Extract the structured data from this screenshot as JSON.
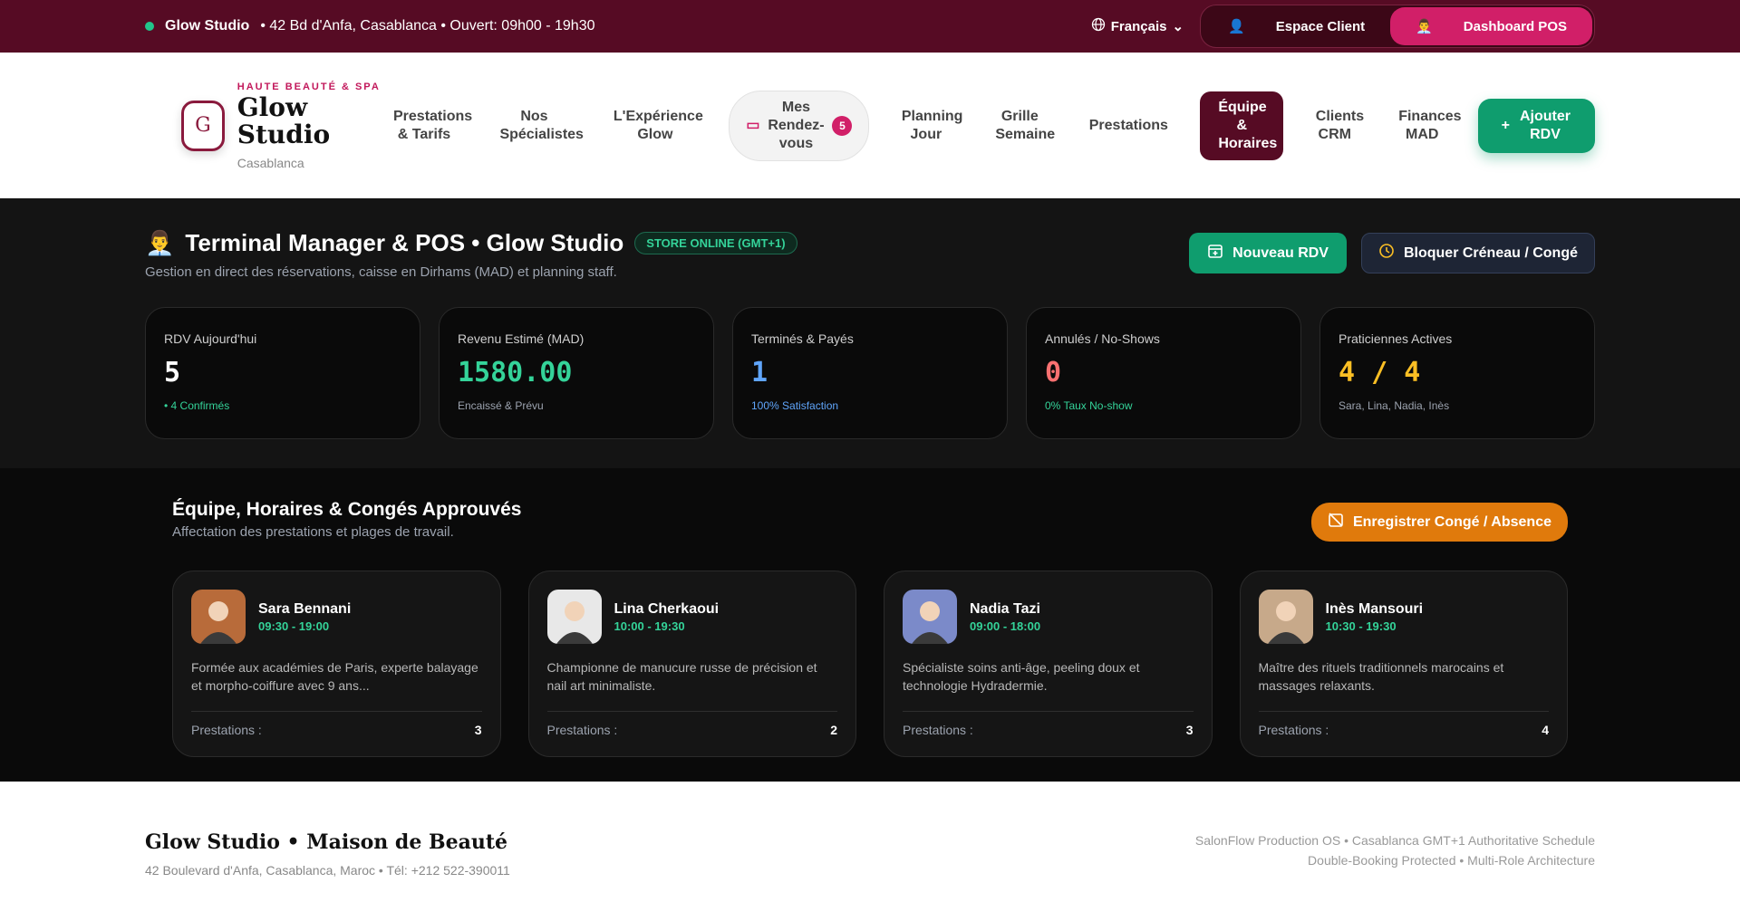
{
  "topbar": {
    "salon": "Glow Studio",
    "info": "• 42 Bd d'Anfa, Casablanca • Ouvert: 09h00 - 19h30",
    "language": "Français",
    "client_space": "Espace Client",
    "dashboard": "Dashboard POS"
  },
  "brand": {
    "tag": "HAUTE BEAUTÉ & SPA",
    "logo_letter": "G",
    "name": "Glow Studio",
    "city": "Casablanca"
  },
  "nav": {
    "items": [
      "Prestations & Tarifs",
      "Nos Spécialistes",
      "L'Expérience Glow"
    ],
    "rdv_label": "Mes Rendez-vous",
    "rdv_count": "5",
    "items2": [
      "Planning Jour",
      "Grille Semaine",
      "Prestations"
    ],
    "active": "Équipe & Horaires",
    "items3": [
      "Clients CRM",
      "Finances MAD"
    ],
    "add": "Ajouter RDV"
  },
  "dashboard": {
    "title": "Terminal Manager & POS • Glow Studio",
    "status": "STORE ONLINE (GMT+1)",
    "subtitle": "Gestion en direct des réservations, caisse en Dirhams (MAD) et planning staff.",
    "new_rdv": "Nouveau RDV",
    "block": "Bloquer Créneau / Congé",
    "kpis": [
      {
        "label": "RDV Aujourd'hui",
        "value": "5",
        "note": "• 4 Confirmés",
        "color": "#ffffff",
        "note_color": "#34d399"
      },
      {
        "label": "Revenu Estimé (MAD)",
        "value": "1580.00",
        "note": "Encaissé & Prévu",
        "color": "#34d399",
        "note_color": "#9ca3af"
      },
      {
        "label": "Terminés & Payés",
        "value": "1",
        "note": "100% Satisfaction",
        "color": "#60a5fa",
        "note_color": "#60a5fa"
      },
      {
        "label": "Annulés / No-Shows",
        "value": "0",
        "note": "0% Taux No-show",
        "color": "#f87171",
        "note_color": "#34d399"
      },
      {
        "label": "Praticiennes Actives",
        "value": "4 / 4",
        "note": "Sara, Lina, Nadia, Inès",
        "color": "#fbbf24",
        "note_color": "#9ca3af"
      }
    ]
  },
  "team": {
    "title": "Équipe, Horaires & Congés Approuvés",
    "subtitle": "Affectation des prestations et plages de travail.",
    "record": "Enregistrer Congé / Absence",
    "members": [
      {
        "name": "Sara Bennani",
        "hours": "09:30 - 19:00",
        "desc": "Formée aux académies de Paris, experte balayage et morpho-coiffure avec 9 ans...",
        "services_label": "Prestations :",
        "services": "3",
        "avatar_color": "#b86b3a"
      },
      {
        "name": "Lina Cherkaoui",
        "hours": "10:00 - 19:30",
        "desc": "Championne de manucure russe de précision et nail art minimaliste.",
        "services_label": "Prestations :",
        "services": "2",
        "avatar_color": "#e8e8e8"
      },
      {
        "name": "Nadia Tazi",
        "hours": "09:00 - 18:00",
        "desc": "Spécialiste soins anti-âge, peeling doux et technologie Hydradermie.",
        "services_label": "Prestations :",
        "services": "3",
        "avatar_color": "#7b8ac9"
      },
      {
        "name": "Inès Mansouri",
        "hours": "10:30 - 19:30",
        "desc": "Maître des rituels traditionnels marocains et massages relaxants.",
        "services_label": "Prestations :",
        "services": "4",
        "avatar_color": "#c7a98a"
      }
    ]
  },
  "footer": {
    "name": "Glow Studio • Maison de Beauté",
    "address": "42 Boulevard d'Anfa, Casablanca, Maroc • Tél: +212 522-390011",
    "right1": "SalonFlow Production OS • Casablanca GMT+1 Authoritative Schedule",
    "right2": "Double-Booking Protected • Multi-Role Architecture"
  }
}
